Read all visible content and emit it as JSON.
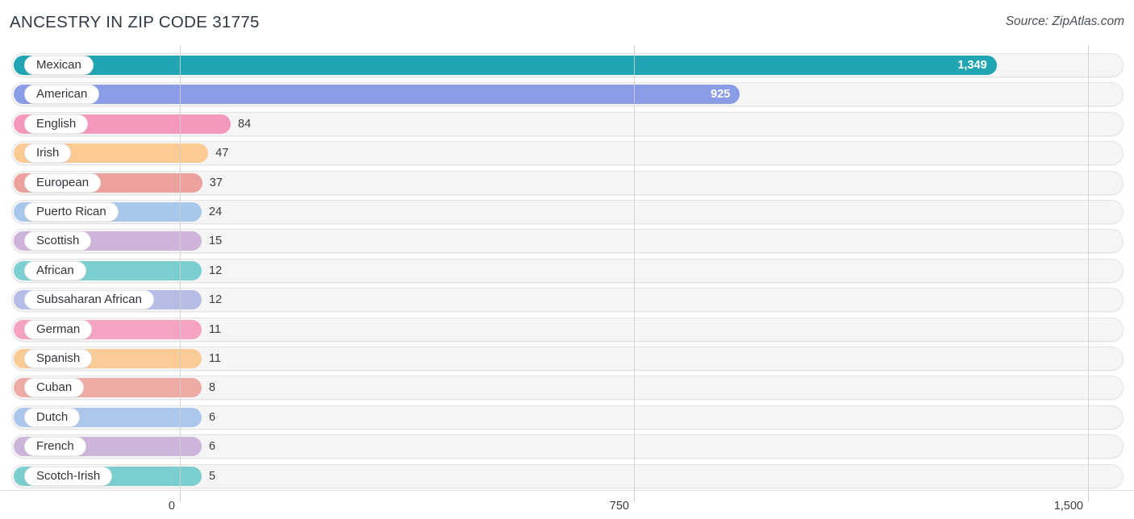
{
  "header": {
    "title": "ANCESTRY IN ZIP CODE 31775",
    "source": "Source: ZipAtlas.com"
  },
  "chart_data": {
    "type": "bar",
    "orientation": "horizontal",
    "title": "ANCESTRY IN ZIP CODE 31775",
    "xlabel": "",
    "ylabel": "",
    "xlim": [
      0,
      1500
    ],
    "grid": true,
    "gridlines_at": [
      0,
      750,
      1500
    ],
    "tick_labels": [
      "0",
      "750",
      "1,500"
    ],
    "legend": "none",
    "categories": [
      "Mexican",
      "American",
      "English",
      "Irish",
      "European",
      "Puerto Rican",
      "Scottish",
      "African",
      "Subsaharan African",
      "German",
      "Spanish",
      "Cuban",
      "Dutch",
      "French",
      "Scotch-Irish"
    ],
    "values": [
      1349,
      925,
      84,
      47,
      37,
      24,
      15,
      12,
      12,
      11,
      11,
      8,
      6,
      6,
      5
    ],
    "value_labels": [
      "1,349",
      "925",
      "84",
      "47",
      "37",
      "24",
      "15",
      "12",
      "12",
      "11",
      "11",
      "8",
      "6",
      "6",
      "5"
    ],
    "colors": [
      "#21a5b3",
      "#8b9ce6",
      "#f598be",
      "#fcca93",
      "#eda19e",
      "#a8c8eb",
      "#ceb4da",
      "#7ccfcf",
      "#b5bde7",
      "#f6a2c2",
      "#fbcb96",
      "#eeaaa4",
      "#abc8ec",
      "#ccb4db",
      "#7acecd"
    ],
    "bars": [
      {
        "label": "Mexican",
        "value": 1349,
        "value_label": "1,349",
        "color": "#21a5b3",
        "label_inside": true
      },
      {
        "label": "American",
        "value": 925,
        "value_label": "925",
        "color": "#8b9ce6",
        "label_inside": true
      },
      {
        "label": "English",
        "value": 84,
        "value_label": "84",
        "color": "#f598be",
        "label_inside": false
      },
      {
        "label": "Irish",
        "value": 47,
        "value_label": "47",
        "color": "#fcca93",
        "label_inside": false
      },
      {
        "label": "European",
        "value": 37,
        "value_label": "37",
        "color": "#eda19e",
        "label_inside": false
      },
      {
        "label": "Puerto Rican",
        "value": 24,
        "value_label": "24",
        "color": "#a8c8eb",
        "label_inside": false
      },
      {
        "label": "Scottish",
        "value": 15,
        "value_label": "15",
        "color": "#ceb4da",
        "label_inside": false
      },
      {
        "label": "African",
        "value": 12,
        "value_label": "12",
        "color": "#7ccfcf",
        "label_inside": false
      },
      {
        "label": "Subsaharan African",
        "value": 12,
        "value_label": "12",
        "color": "#b5bde7",
        "label_inside": false
      },
      {
        "label": "German",
        "value": 11,
        "value_label": "11",
        "color": "#f6a2c2",
        "label_inside": false
      },
      {
        "label": "Spanish",
        "value": 11,
        "value_label": "11",
        "color": "#fbcb96",
        "label_inside": false
      },
      {
        "label": "Cuban",
        "value": 8,
        "value_label": "8",
        "color": "#eeaaa4",
        "label_inside": false
      },
      {
        "label": "Dutch",
        "value": 6,
        "value_label": "6",
        "color": "#abc8ec",
        "label_inside": false
      },
      {
        "label": "French",
        "value": 6,
        "value_label": "6",
        "color": "#ccb4db",
        "label_inside": false
      },
      {
        "label": "Scotch-Irish",
        "value": 5,
        "value_label": "5",
        "color": "#7acecd",
        "label_inside": false
      }
    ]
  },
  "axis": {
    "ticks": [
      {
        "label": "0",
        "value": 0
      },
      {
        "label": "750",
        "value": 750
      },
      {
        "label": "1,500",
        "value": 1500
      }
    ]
  }
}
